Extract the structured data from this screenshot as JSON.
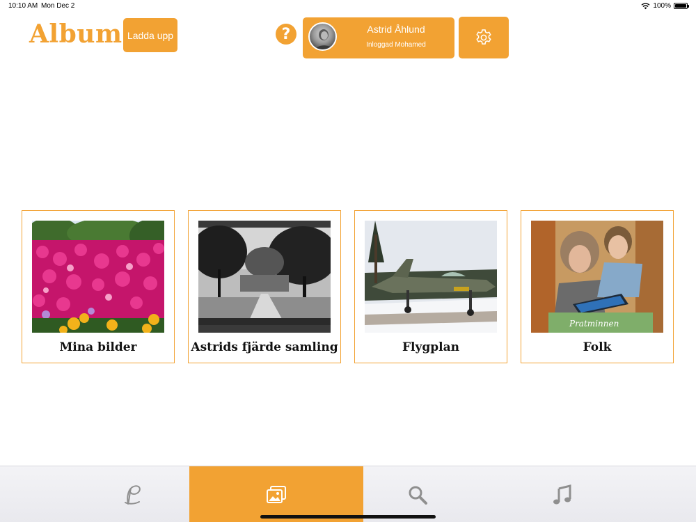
{
  "status_bar": {
    "time": "10:10 AM",
    "date": "Mon Dec 2",
    "battery": "100%",
    "battery_level": 1.0
  },
  "header": {
    "title": "Album",
    "upload_label": "Ladda upp",
    "help_label": "?",
    "profile": {
      "name": "Astrid Åhlund",
      "logged_in_text": "Inloggad  Mohamed"
    },
    "settings_icon": "gear-icon"
  },
  "albums": [
    {
      "title": "Mina bilder"
    },
    {
      "title": "Astrids fjärde samling"
    },
    {
      "title": "Flygplan"
    },
    {
      "title": "Folk"
    }
  ],
  "tab_bar": {
    "tabs": [
      {
        "icon": "script-p-icon",
        "active": false
      },
      {
        "icon": "photos-icon",
        "active": true
      },
      {
        "icon": "search-icon",
        "active": false
      },
      {
        "icon": "music-note-icon",
        "active": false
      }
    ],
    "active_color": "#f2a233"
  },
  "colors": {
    "accent": "#f2a233"
  }
}
